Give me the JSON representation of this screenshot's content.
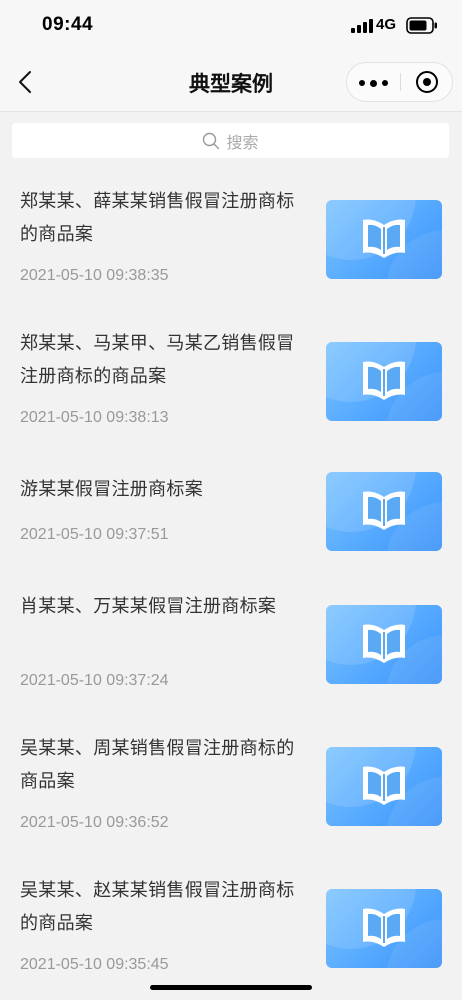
{
  "status_bar": {
    "time": "09:44",
    "network": "4G"
  },
  "nav": {
    "title": "典型案例"
  },
  "search": {
    "placeholder": "搜索"
  },
  "cases": [
    {
      "title": "郑某某、薛某某销售假冒注册商标的商品案",
      "date": "2021-05-10 09:38:35"
    },
    {
      "title": "郑某某、马某甲、马某乙销售假冒注册商标的商品案",
      "date": "2021-05-10 09:38:13"
    },
    {
      "title": "游某某假冒注册商标案",
      "date": "2021-05-10 09:37:51"
    },
    {
      "title": "肖某某、万某某假冒注册商标案",
      "date": "2021-05-10 09:37:24"
    },
    {
      "title": "吴某某、周某销售假冒注册商标的商品案",
      "date": "2021-05-10 09:36:52"
    },
    {
      "title": "吴某某、赵某某销售假冒注册商标的商品案",
      "date": "2021-05-10 09:35:45"
    }
  ],
  "icons": {
    "back": "chevron-left-icon",
    "more": "more-dots-icon",
    "close": "target-close-icon",
    "search": "search-icon",
    "thumbnail": "open-book-icon"
  },
  "colors": {
    "thumbnail_blue": "#55a9ff",
    "date_gray": "#999999",
    "title_text": "#333333"
  }
}
